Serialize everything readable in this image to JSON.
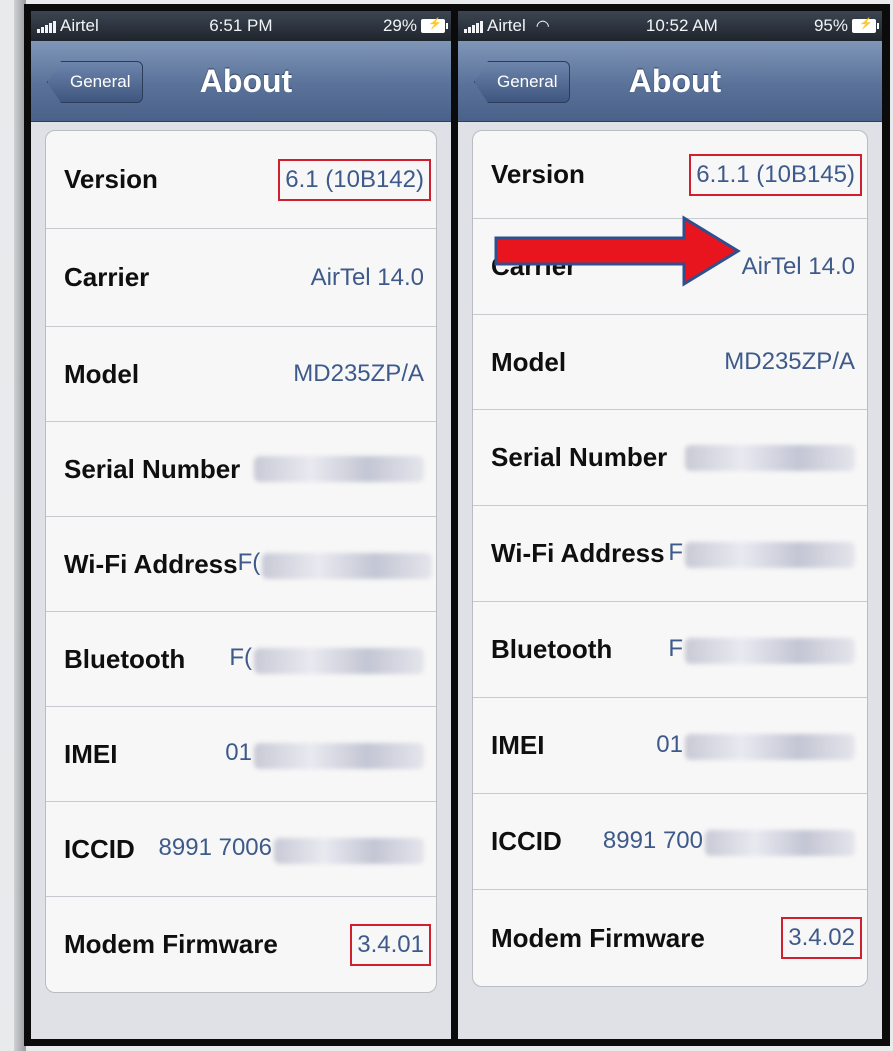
{
  "left": {
    "status": {
      "carrier": "Airtel",
      "time": "6:51 PM",
      "battery": "29%"
    },
    "nav": {
      "back": "General",
      "title": "About"
    },
    "rows": [
      {
        "label": "Version",
        "value": "6.1 (10B142)"
      },
      {
        "label": "Carrier",
        "value": "AirTel 14.0"
      },
      {
        "label": "Model",
        "value": "MD235ZP/A"
      },
      {
        "label": "Serial Number",
        "value": ""
      },
      {
        "label": "Wi-Fi Address",
        "value": "F("
      },
      {
        "label": "Bluetooth",
        "value": "F("
      },
      {
        "label": "IMEI",
        "value": "01"
      },
      {
        "label": "ICCID",
        "value": "8991 7006"
      },
      {
        "label": "Modem Firmware",
        "value": "3.4.01"
      }
    ]
  },
  "right": {
    "status": {
      "carrier": "Airtel",
      "time": "10:52 AM",
      "battery": "95%"
    },
    "nav": {
      "back": "General",
      "title": "About"
    },
    "rows": [
      {
        "label": "Version",
        "value": "6.1.1 (10B145)"
      },
      {
        "label": "Carrier",
        "value": "AirTel 14.0"
      },
      {
        "label": "Model",
        "value": "MD235ZP/A"
      },
      {
        "label": "Serial Number",
        "value": ""
      },
      {
        "label": "Wi-Fi Address",
        "value": "F"
      },
      {
        "label": "Bluetooth",
        "value": "F"
      },
      {
        "label": "IMEI",
        "value": "01"
      },
      {
        "label": "ICCID",
        "value": "8991 700"
      },
      {
        "label": "Modem Firmware",
        "value": "3.4.02"
      }
    ]
  },
  "colors": {
    "highlight": "#d02030",
    "arrow": "#e8141e",
    "arrow_outline": "#2f4f8f",
    "value_text": "#3e5a8a"
  }
}
